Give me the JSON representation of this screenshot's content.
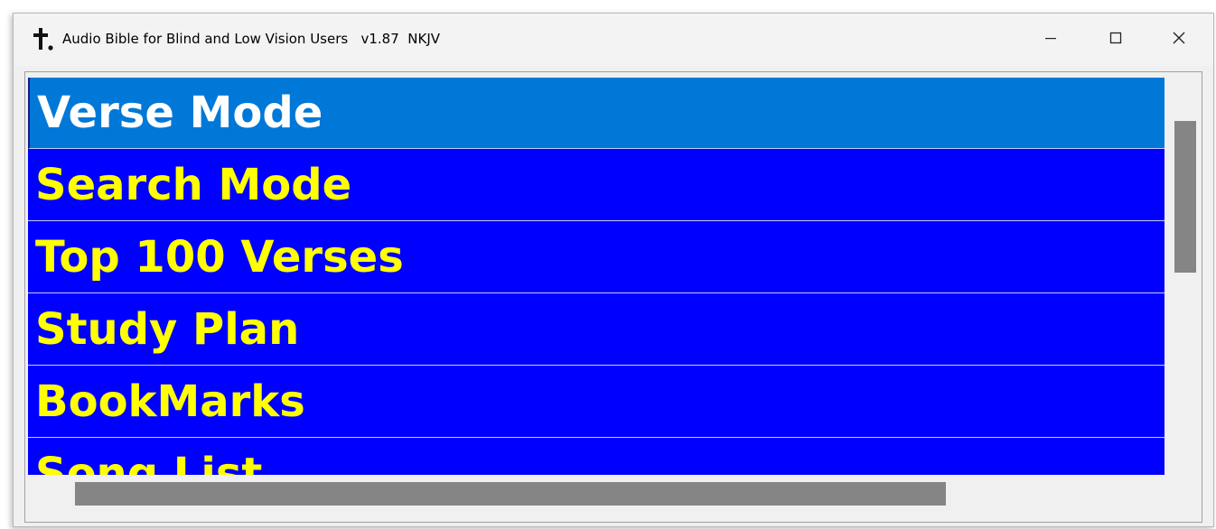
{
  "window": {
    "title": "Audio Bible for Blind and Low Vision Users   v1.87  NKJV",
    "app_icon": "cross-icon",
    "controls": {
      "minimize": "minimize-icon",
      "maximize": "maximize-icon",
      "close": "close-icon"
    }
  },
  "menu": {
    "selected_index": 0,
    "items": [
      {
        "label": "Verse Mode"
      },
      {
        "label": "Search Mode"
      },
      {
        "label": "Top 100 Verses"
      },
      {
        "label": "Study Plan"
      },
      {
        "label": "BookMarks"
      },
      {
        "label": "Song List"
      }
    ]
  },
  "colors": {
    "list_background": "#0000ff",
    "item_text": "#ffff00",
    "selected_background": "#0078d7",
    "selected_text": "#ffffff",
    "scroll_thumb": "#858585"
  }
}
